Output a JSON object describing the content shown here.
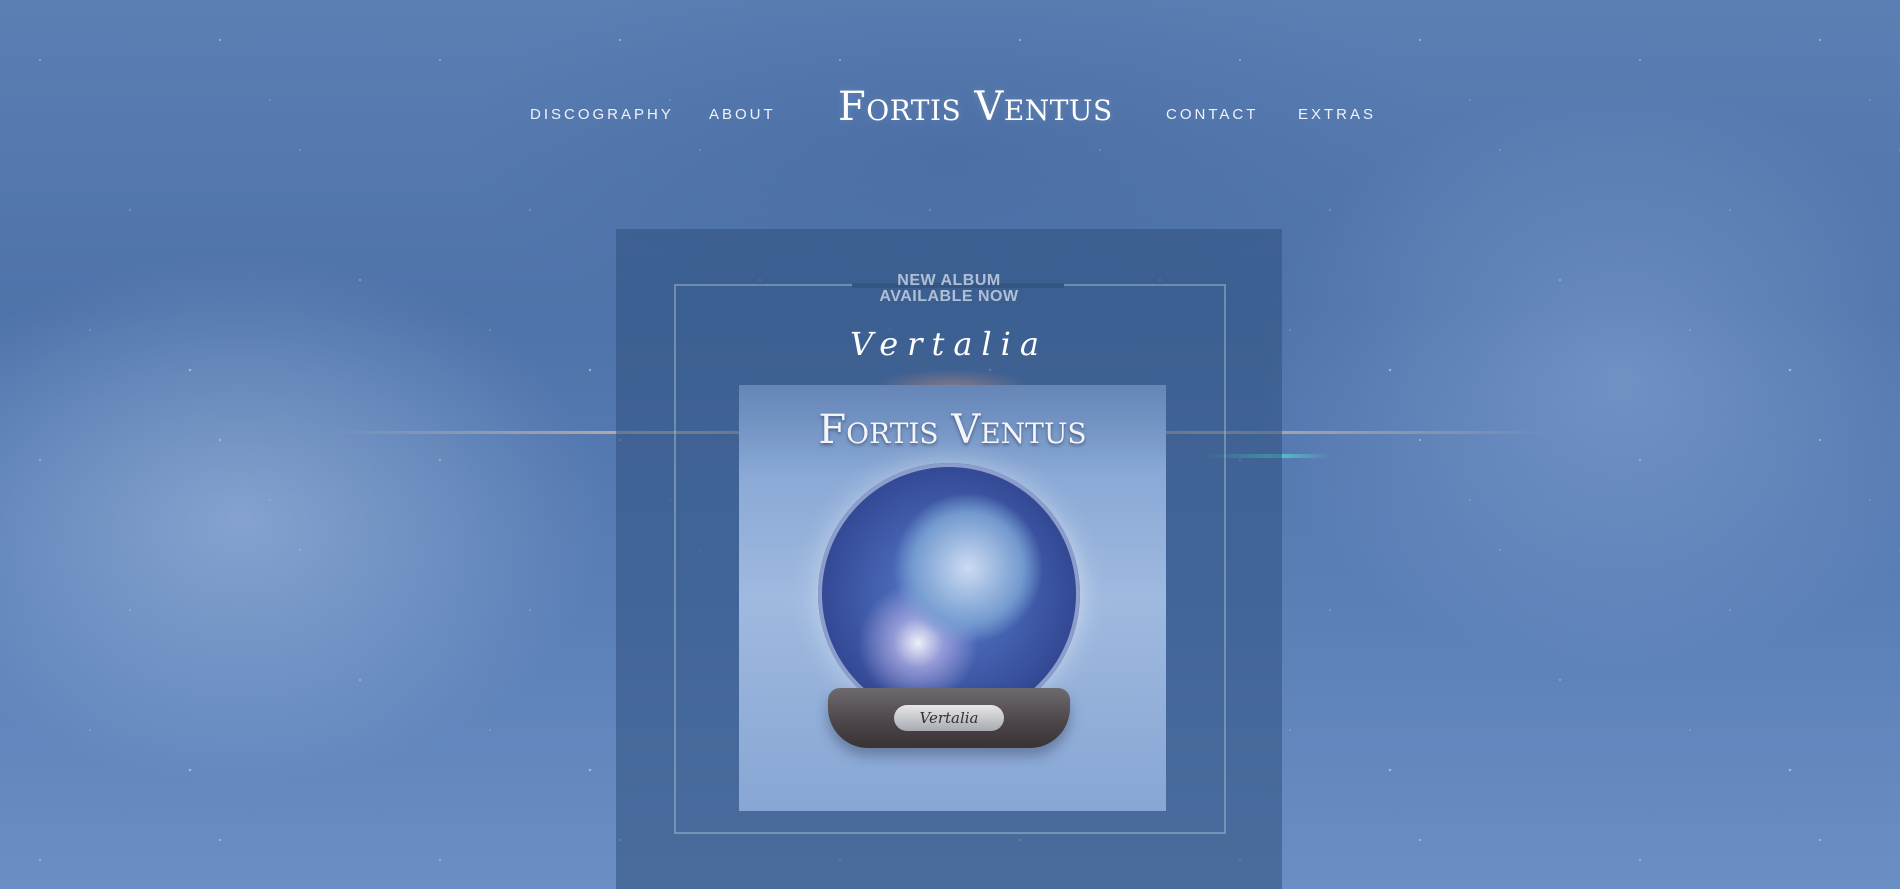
{
  "nav": {
    "left_items": [
      "DISCOGRAPHY",
      "ABOUT"
    ],
    "right_items": [
      "CONTACT",
      "EXTRAS"
    ],
    "logo": "Fortis Ventus"
  },
  "promo": {
    "headline_line1": "NEW ALBUM",
    "headline_line2": "AVAILABLE NOW",
    "album_title": "Vertalia"
  },
  "cover": {
    "band_name": "Fortis Ventus",
    "plaque_text": "Vertalia",
    "image_name": "snow-globe-album-cover"
  },
  "colors": {
    "background": "#5b7fb3",
    "panel": "#30507d",
    "text": "#eef3fb"
  }
}
